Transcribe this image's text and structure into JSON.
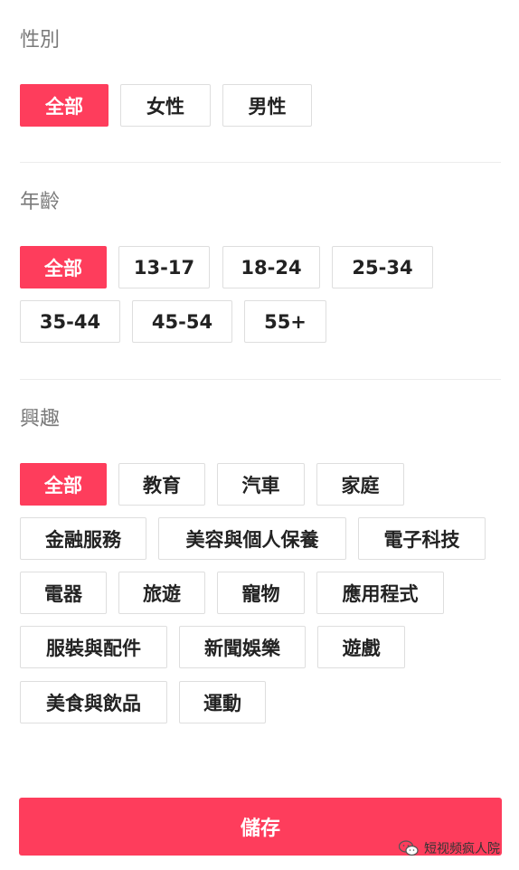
{
  "gender": {
    "title": "性別",
    "options": [
      "全部",
      "女性",
      "男性"
    ]
  },
  "age": {
    "title": "年齡",
    "options": [
      "全部",
      "13-17",
      "18-24",
      "25-34",
      "35-44",
      "45-54",
      "55+"
    ]
  },
  "interest": {
    "title": "興趣",
    "options": [
      "全部",
      "教育",
      "汽車",
      "家庭",
      "金融服務",
      "美容與個人保養",
      "電子科技",
      "電器",
      "旅遊",
      "寵物",
      "應用程式",
      "服裝與配件",
      "新聞娛樂",
      "遊戲",
      "美食與飲品",
      "運動"
    ]
  },
  "actions": {
    "save_label": "儲存"
  },
  "watermark": {
    "text": "短视频疯人院",
    "icon": "wechat-icon"
  },
  "colors": {
    "accent": "#fe3d5c",
    "chip_border": "#dedede",
    "title_gray": "#7a7a7a"
  }
}
